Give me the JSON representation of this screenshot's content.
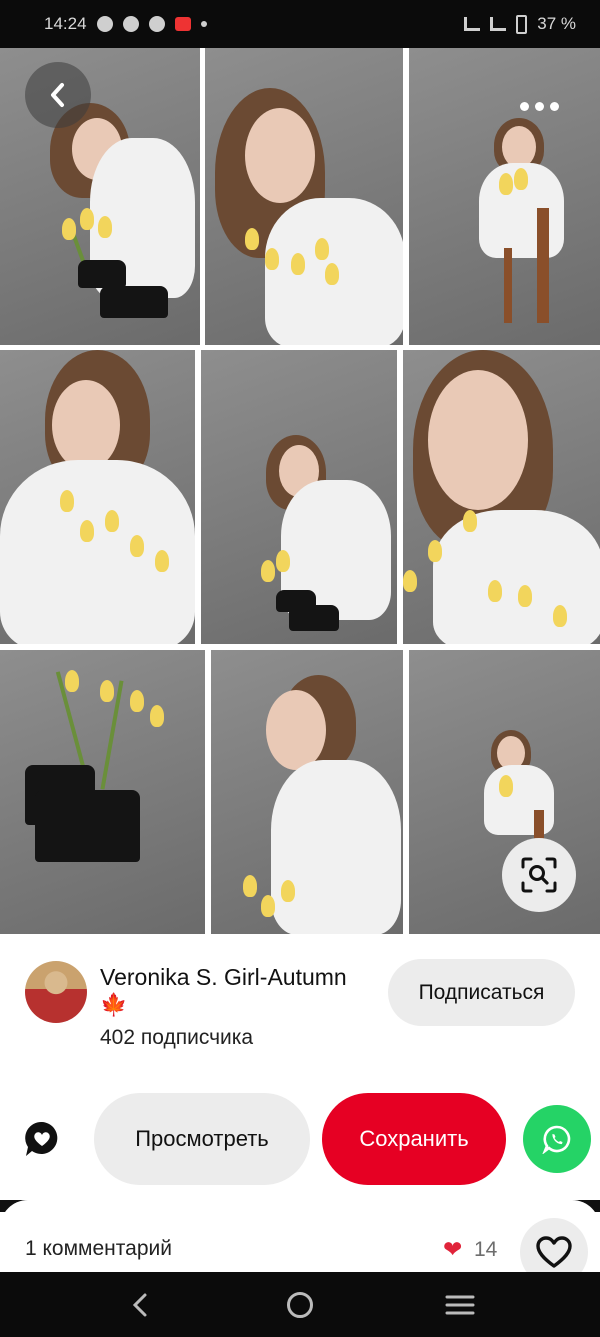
{
  "status_bar": {
    "time": "14:24",
    "battery": "37 %"
  },
  "pin": {
    "back_icon": "chevron-left-icon",
    "more_icon": "more-horizontal-icon",
    "lens_icon": "visual-search-icon",
    "photo_count": 9
  },
  "creator": {
    "name": "Veronika S. Girl-Autumn",
    "emoji": "🍁",
    "followers": "402 подписчика",
    "follow_label": "Подписаться"
  },
  "actions": {
    "react_icon": "heart-bubble-icon",
    "view_label": "Просмотреть",
    "save_label": "Сохранить",
    "share_icon": "whatsapp-icon",
    "save_color": "#e60023",
    "share_color": "#25d366"
  },
  "comments": {
    "count_label": "1 комментарий",
    "reaction_icon": "heart-emoji-icon",
    "reaction_count": "14",
    "like_icon": "heart-outline-icon"
  },
  "nav": {
    "back": "back-nav-icon",
    "home": "home-nav-icon",
    "recents": "recents-nav-icon"
  }
}
